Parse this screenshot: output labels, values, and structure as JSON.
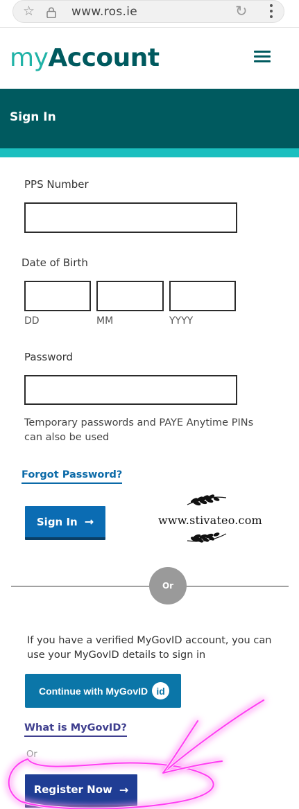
{
  "browser": {
    "url": "www.ros.ie",
    "icons": {
      "bookmark": "star-icon",
      "security": "lock-icon",
      "reload": "reload-icon",
      "menu": "more-vert-icon"
    }
  },
  "header": {
    "brand_my": "my",
    "brand_account": "Account",
    "menu_icon": "hamburger-menu-icon"
  },
  "signin": {
    "title": "Sign In"
  },
  "form": {
    "pps_label": "PPS Number",
    "pps_value": "",
    "dob_label": "Date of Birth",
    "dob_dd_hint": "DD",
    "dob_mm_hint": "MM",
    "dob_yyyy_hint": "YYYY",
    "password_label": "Password",
    "password_value": "",
    "note": "Temporary passwords and PAYE Anytime PINs can also be used",
    "forgot_link": "Forgot Password?",
    "signin_button": "Sign In",
    "arrow": "→"
  },
  "watermark": {
    "text": "www.stivateo.com"
  },
  "divider": {
    "or_label": "Or"
  },
  "mygovid": {
    "text": "If you have a verified MyGovID account, you can use your MyGovID details to sign in",
    "button_label": "Continue with MyGovID",
    "badge": "id",
    "what_link": "What is MyGovID?",
    "or_small": "Or",
    "register_button": "Register Now",
    "arrow": "→"
  },
  "colors": {
    "brand_teal_dark": "#005a5f",
    "brand_teal_light": "#21b3a7",
    "strip": "#1bbfbf",
    "primary_blue": "#0b6cb3",
    "link_blue": "#0b6aa8",
    "overlay_magenta": "#ff3df2"
  }
}
